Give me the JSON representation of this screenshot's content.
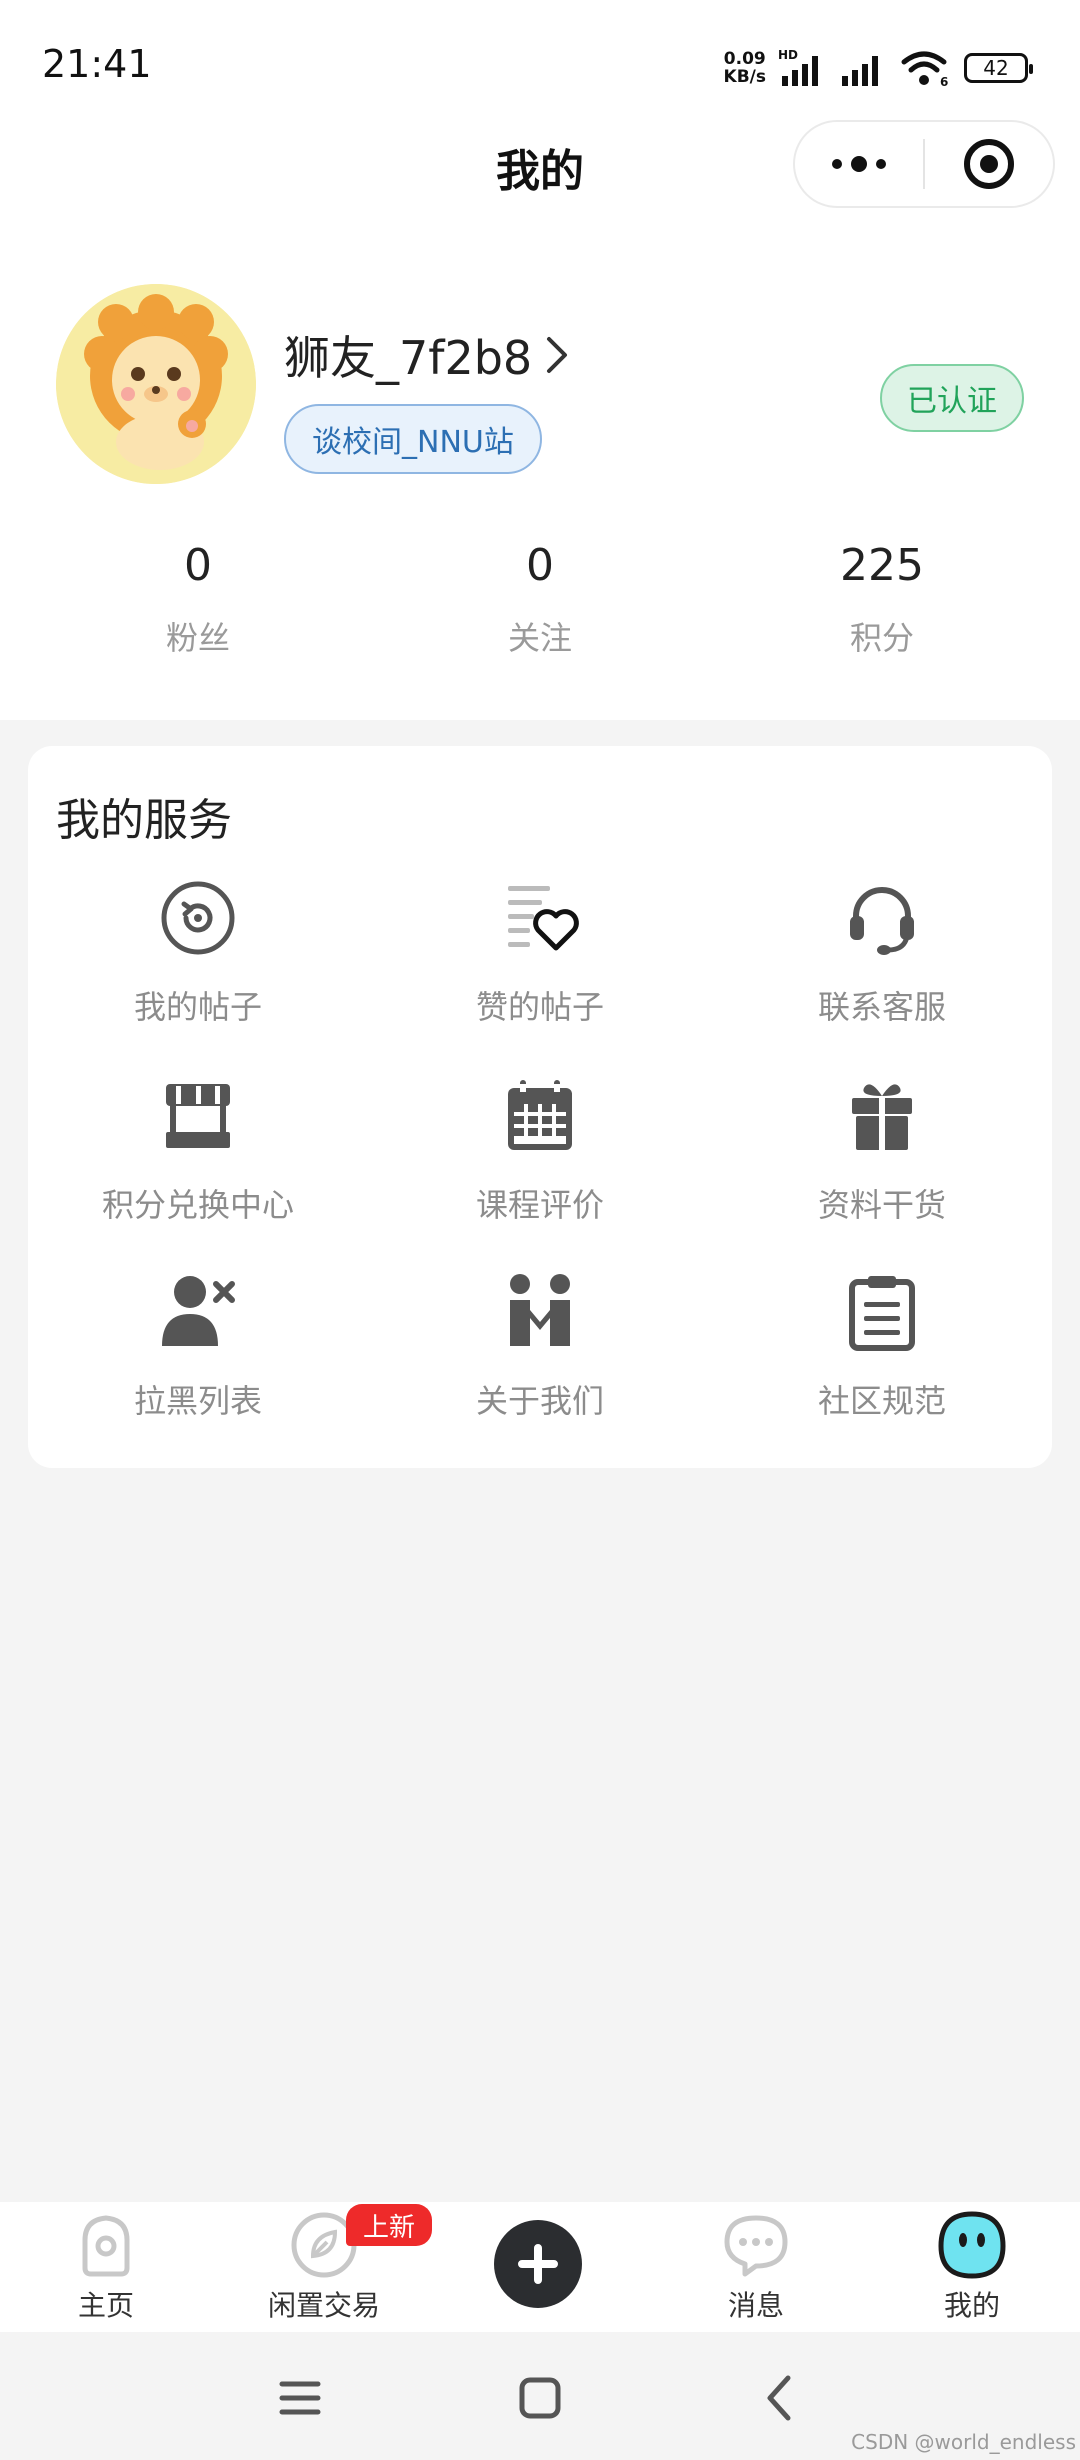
{
  "status_bar": {
    "time": "21:41",
    "net_speed_value": "0.09",
    "net_speed_unit": "KB/s",
    "battery": "42"
  },
  "nav": {
    "title": "我的"
  },
  "profile": {
    "username": "狮友_7f2b8",
    "campus": "谈校间_NNU站",
    "verified": "已认证"
  },
  "stats": [
    {
      "value": "0",
      "label": "粉丝"
    },
    {
      "value": "0",
      "label": "关注"
    },
    {
      "value": "225",
      "label": "积分"
    }
  ],
  "services": {
    "title": "我的服务",
    "items": [
      {
        "label": "我的帖子",
        "icon": "my-posts-icon"
      },
      {
        "label": "赞的帖子",
        "icon": "liked-posts-icon"
      },
      {
        "label": "联系客服",
        "icon": "headset-icon"
      },
      {
        "label": "积分兑换中心",
        "icon": "store-icon"
      },
      {
        "label": "课程评价",
        "icon": "calendar-icon"
      },
      {
        "label": "资料干货",
        "icon": "gift-icon"
      },
      {
        "label": "拉黑列表",
        "icon": "block-user-icon"
      },
      {
        "label": "关于我们",
        "icon": "people-icon"
      },
      {
        "label": "社区规范",
        "icon": "clipboard-icon"
      }
    ]
  },
  "tabbar": {
    "items": [
      {
        "label": "主页",
        "icon": "home-icon"
      },
      {
        "label": "闲置交易",
        "icon": "leaf-icon"
      },
      {
        "label": "消息",
        "icon": "message-icon"
      },
      {
        "label": "我的",
        "icon": "mine-face-icon"
      }
    ],
    "new_badge": "上新"
  },
  "watermark": "CSDN @world_endless",
  "colors": {
    "verified_green": "#21a35a",
    "campus_blue": "#2c6fb3",
    "badge_red": "#ee2a2a",
    "mine_cyan": "#6fe3f0"
  }
}
